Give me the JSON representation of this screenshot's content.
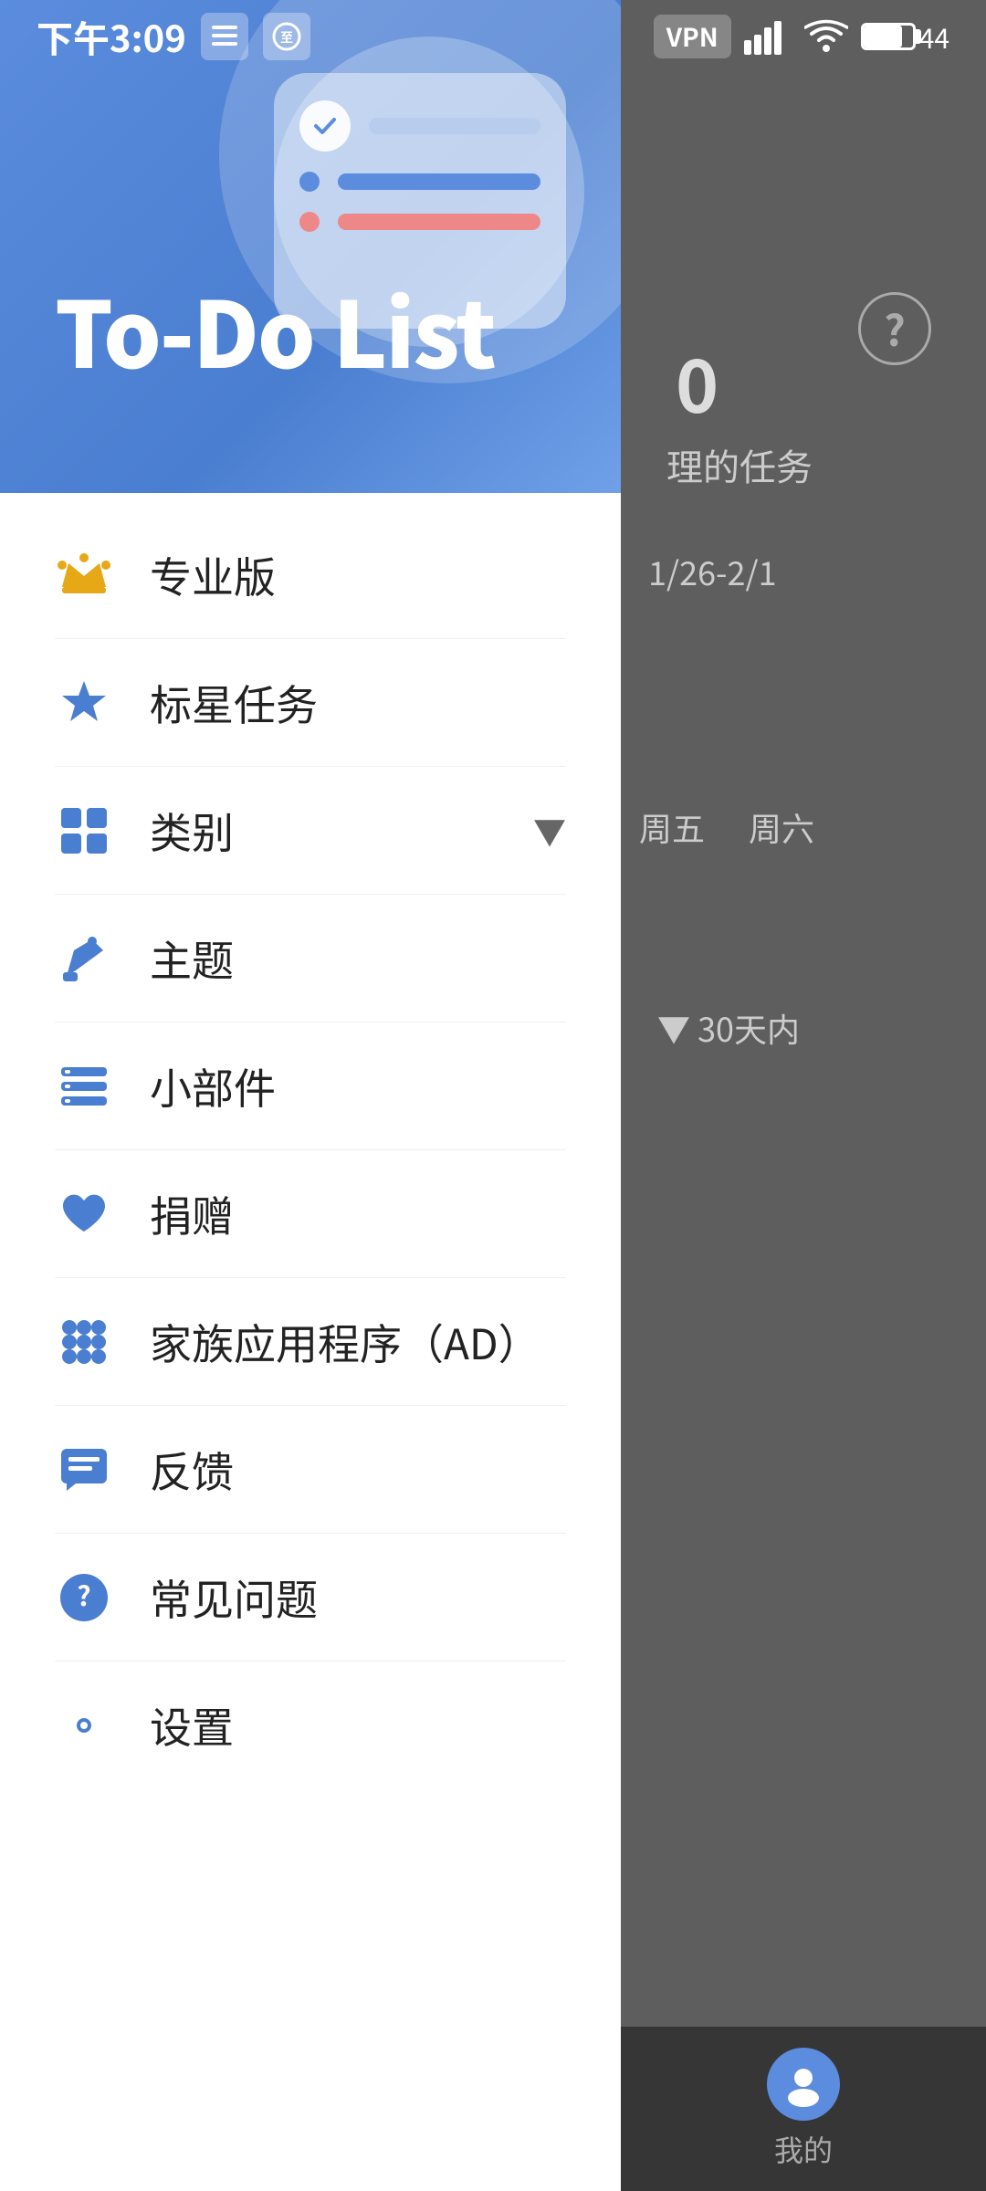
{
  "statusBar": {
    "time": "下午3:09",
    "vpn": "VPN",
    "battery": "44"
  },
  "drawer": {
    "title": "To-Do List",
    "menuItems": [
      {
        "id": "pro",
        "label": "专业版",
        "icon": "crown"
      },
      {
        "id": "starred",
        "label": "标星任务",
        "icon": "star"
      },
      {
        "id": "category",
        "label": "类别",
        "icon": "grid",
        "hasArrow": true
      },
      {
        "id": "theme",
        "label": "主题",
        "icon": "paint"
      },
      {
        "id": "widget",
        "label": "小部件",
        "icon": "widget"
      },
      {
        "id": "donate",
        "label": "捐赠",
        "icon": "heart"
      },
      {
        "id": "family",
        "label": "家族应用程序（AD）",
        "icon": "apps"
      },
      {
        "id": "feedback",
        "label": "反馈",
        "icon": "feedback"
      },
      {
        "id": "faq",
        "label": "常见问题",
        "icon": "faq"
      },
      {
        "id": "settings",
        "label": "设置",
        "icon": "settings"
      }
    ]
  },
  "bgRight": {
    "dateRange": "1/26-2/1",
    "daysLabel": "30天内",
    "bottomNavLabel": "我的"
  },
  "todoCard": {
    "rows": [
      {
        "type": "check",
        "lineColor": "#c8d8f5",
        "dotColor": null
      },
      {
        "type": "dot",
        "lineColor": "#5b8cdd",
        "dotColor": "#5b8cdd"
      },
      {
        "type": "dot",
        "lineColor": "#e88",
        "dotColor": "#e88"
      }
    ]
  }
}
